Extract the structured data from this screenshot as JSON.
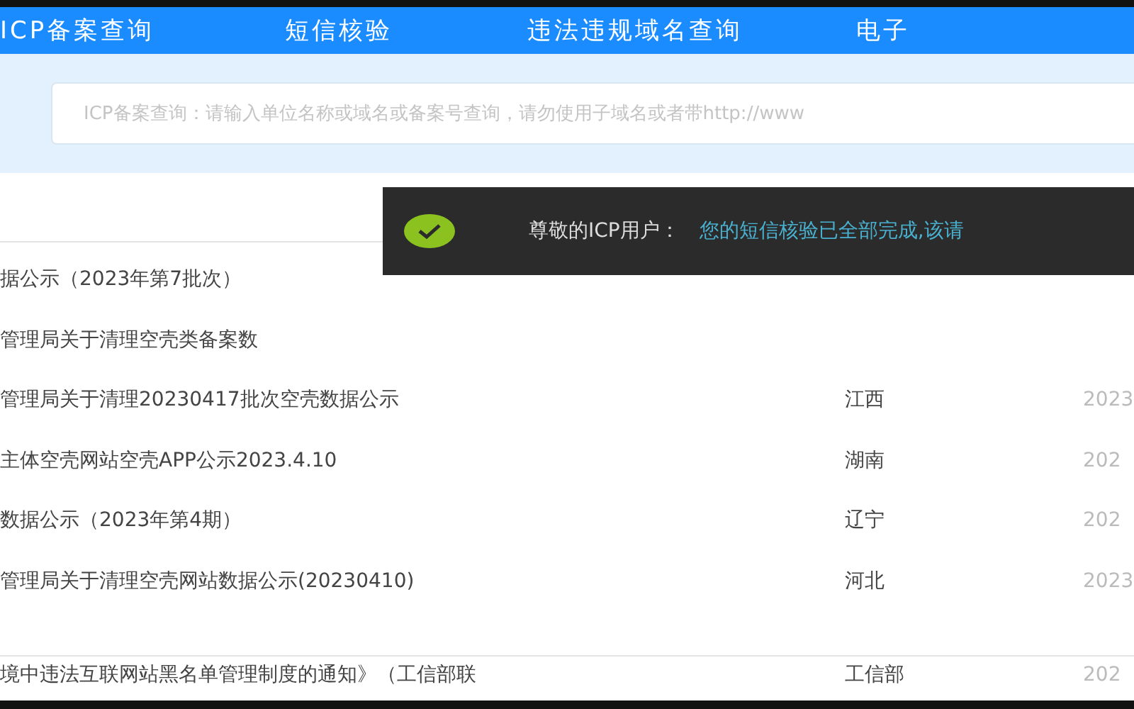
{
  "nav": [
    {
      "label": "ICP备案查询",
      "selected": false
    },
    {
      "label": "短信核验",
      "selected": false
    },
    {
      "label": "违法违规域名查询",
      "selected": false
    },
    {
      "label": "电子",
      "selected": false
    }
  ],
  "search": {
    "placeholder": "ICP备案查询：请输入单位名称或域名或备案号查询，请勿使用子域名或者带http://www"
  },
  "notices": [
    {
      "title": "据公示（2023年第7批次）"
    },
    {
      "title": "管理局关于清理空壳类备案数"
    },
    {
      "title": "管理局关于清理20230417批次空壳数据公示",
      "region": "江西",
      "date": "2023"
    },
    {
      "title": "主体空壳网站空壳APP公示2023.4.10",
      "region": "湖南",
      "date": "202"
    },
    {
      "title": "数据公示（2023年第4期）",
      "region": "辽宁",
      "date": "202"
    },
    {
      "title": "管理局关于清理空壳网站数据公示(20230410)",
      "region": "河北",
      "date": "2023"
    }
  ],
  "bottom_row": {
    "title": "境中违法互联网站黑名单管理制度的通知》（工信部联",
    "region": "工信部",
    "date": "202"
  },
  "toast": {
    "greeting": "尊敬的ICP用户：",
    "message": "您的短信核验已全部完成,该请"
  }
}
